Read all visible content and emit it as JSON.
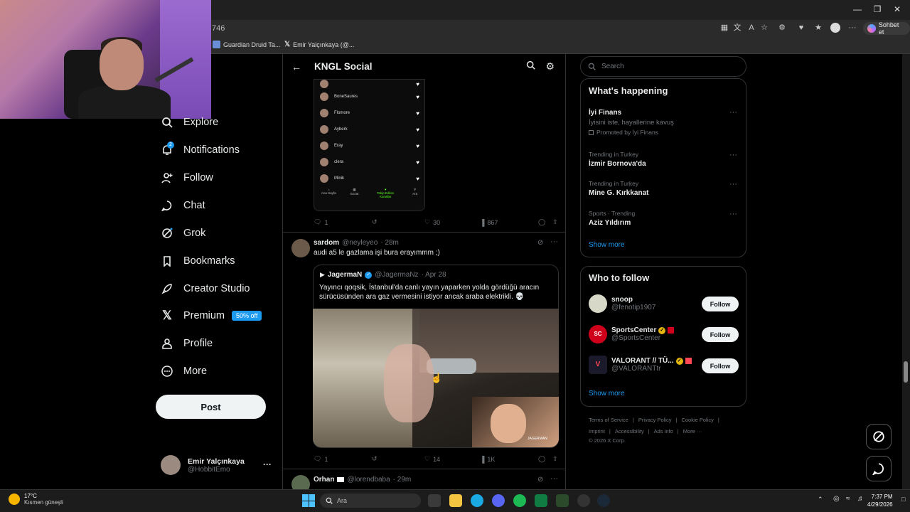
{
  "browser": {
    "url_fragment": "746",
    "bookmarks": [
      {
        "label": "Guardian Druid Ta..."
      },
      {
        "label": "Emir Yalçınkaya (@..."
      }
    ],
    "copilot_label": "Sohbet et",
    "window_controls": [
      "minimize-icon",
      "restore-icon",
      "close-icon"
    ]
  },
  "sidebar": {
    "items": [
      {
        "label": "Explore",
        "icon": "search-icon"
      },
      {
        "label": "Notifications",
        "icon": "bell-icon",
        "badge": "2"
      },
      {
        "label": "Follow",
        "icon": "person-plus-icon"
      },
      {
        "label": "Chat",
        "icon": "chat-bubble-icon"
      },
      {
        "label": "Grok",
        "icon": "grok-icon"
      },
      {
        "label": "Bookmarks",
        "icon": "bookmark-icon"
      },
      {
        "label": "Creator Studio",
        "icon": "rocket-icon"
      },
      {
        "label": "Premium",
        "icon": "x-logo-icon",
        "badge": "50% off"
      },
      {
        "label": "Profile",
        "icon": "person-icon"
      },
      {
        "label": "More",
        "icon": "more-circle-icon"
      }
    ],
    "post_button": "Post",
    "account": {
      "name": "Emir Yalçınkaya",
      "handle": "@HobbitEmo",
      "menu": "···"
    }
  },
  "main": {
    "header_title": "KNGL Social",
    "first_post": {
      "phone_rows": [
        {
          "name": "BoneSaures"
        },
        {
          "name": "Flomore"
        },
        {
          "name": "Ayberk"
        },
        {
          "name": "Eray"
        },
        {
          "name": "clera"
        },
        {
          "name": "Minik"
        }
      ],
      "phone_tabs": [
        {
          "label": "Ana Sayfa"
        },
        {
          "label": "Gözat"
        },
        {
          "label": "Takip Edilen Kanallar"
        },
        {
          "label": "Ara"
        }
      ],
      "replies": "1",
      "likes": "30",
      "views": "867"
    },
    "second_post": {
      "author": "sardom",
      "handle": "@neyleyeo",
      "time": "· 28m",
      "text": "audi a5 le gazlama işi bura erayımmm ;)",
      "quoted": {
        "author": "JagermaN",
        "handle": "@JagermaNz",
        "time": "· Apr 28",
        "text": "Yayıncı qoqsik, İstanbul'da canlı yayın yaparken yolda gördüğü aracın sürücüsünden ara gaz vermesini istiyor ancak araba elektrikli. 💀",
        "watermark": "JAGERMAN"
      },
      "replies": "1",
      "likes": "14",
      "views": "1K"
    },
    "third_post": {
      "author": "Orhan",
      "handle": "@lorendbaba",
      "time": "· 29m"
    }
  },
  "right": {
    "search_placeholder": "Search",
    "whats_happening": {
      "title": "What's happening",
      "items": [
        {
          "meta": "",
          "name": "İyi Finans",
          "sub": "İyisini iste, hayallerine kavuş",
          "promo": "Promoted by İyi Finans"
        },
        {
          "meta": "Trending in Turkey",
          "name": "İzmir Bornova'da"
        },
        {
          "meta": "Trending in Turkey",
          "name": "Mine G. Kırkkanat"
        },
        {
          "meta": "Sports · Trending",
          "name": "Aziz Yıldırım"
        }
      ],
      "show_more": "Show more"
    },
    "who_to_follow": {
      "title": "Who to follow",
      "accounts": [
        {
          "name": "snoop",
          "handle": "@fenotip1907",
          "button": "Follow"
        },
        {
          "name": "SportsCenter",
          "handle": "@SportsCenter",
          "button": "Follow"
        },
        {
          "name": "VALORANT // TÜ...",
          "handle": "@VALORANTtr",
          "button": "Follow"
        }
      ],
      "show_more": "Show more"
    },
    "footer": {
      "line1": [
        "Terms of Service",
        "Privacy Policy",
        "Cookie Policy"
      ],
      "line2": [
        "Imprint",
        "Accessibility",
        "Ads info",
        "More ···"
      ],
      "copyright": "© 2026 X Corp."
    }
  },
  "taskbar": {
    "weather_temp": "17°C",
    "weather_desc": "Kısmen güneşli",
    "search_placeholder": "Ara",
    "time": "7:37 PM",
    "date": "4/29/2026"
  },
  "colors": {
    "accent": "#1d9bf0",
    "background": "#000000",
    "text": "#e7e9ea",
    "muted": "#71767b",
    "border": "#2f3336"
  }
}
